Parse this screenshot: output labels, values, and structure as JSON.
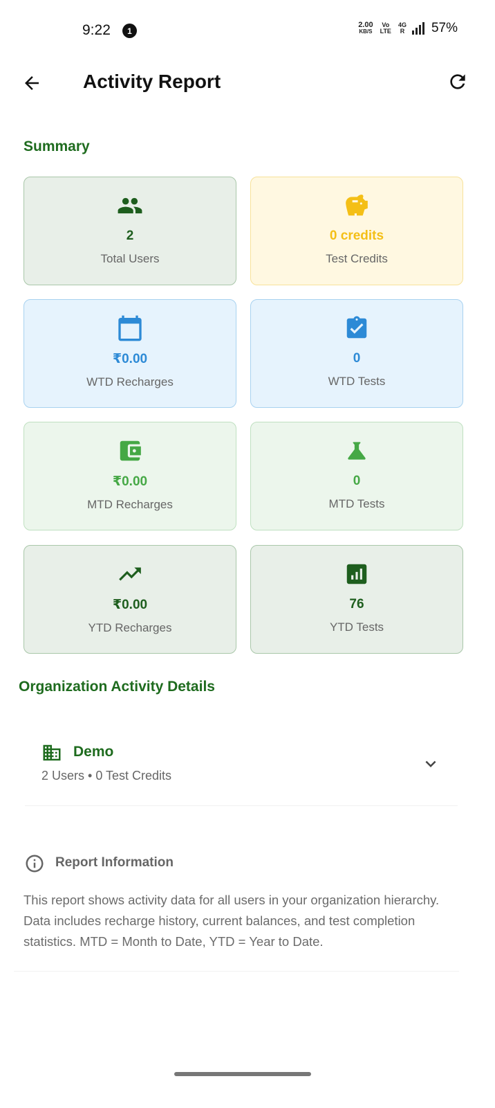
{
  "status_bar": {
    "time": "9:22",
    "notification_count": "1",
    "speed_value": "2.00",
    "speed_unit": "KB/S",
    "volte_top": "Vo",
    "volte_bottom": "LTE",
    "network": "4G",
    "network_sub": "R",
    "battery": "57%"
  },
  "app_bar": {
    "title": "Activity Report",
    "back_icon": "arrow-left-icon",
    "refresh_icon": "refresh-icon"
  },
  "summary": {
    "title": "Summary",
    "cards": [
      {
        "icon": "people-icon",
        "value": "2",
        "label": "Total Users",
        "value_color": "#1e5e1e"
      },
      {
        "icon": "piggy-bank-icon",
        "value": "0 credits",
        "label": "Test Credits",
        "value_color": "#f4bf16"
      },
      {
        "icon": "calendar-icon",
        "value": "₹0.00",
        "label": "WTD Recharges",
        "value_color": "#2d8ad6"
      },
      {
        "icon": "clipboard-check-icon",
        "value": "0",
        "label": "WTD Tests",
        "value_color": "#2d8ad6"
      },
      {
        "icon": "wallet-icon",
        "value": "₹0.00",
        "label": "MTD Recharges",
        "value_color": "#45a845"
      },
      {
        "icon": "flask-icon",
        "value": "0",
        "label": "MTD Tests",
        "value_color": "#45a845"
      },
      {
        "icon": "trending-up-icon",
        "value": "₹0.00",
        "label": "YTD Recharges",
        "value_color": "#1e5e1e"
      },
      {
        "icon": "bar-chart-icon",
        "value": "76",
        "label": "YTD Tests",
        "value_color": "#1e5e1e"
      }
    ]
  },
  "organization": {
    "title": "Organization Activity Details",
    "items": [
      {
        "icon": "building-icon",
        "name": "Demo",
        "subtitle": "2 Users • 0 Test Credits"
      }
    ]
  },
  "report_info": {
    "icon": "info-icon",
    "title": "Report Information",
    "text": "This report shows activity data for all users in your organization hierarchy. Data includes recharge history, current balances, and test completion statistics. MTD = Month to Date, YTD = Year to Date."
  },
  "colors": {
    "accent_green": "#1e6b1e",
    "yellow": "#f4bf16",
    "blue": "#2d8ad6",
    "light_green": "#45a845"
  }
}
